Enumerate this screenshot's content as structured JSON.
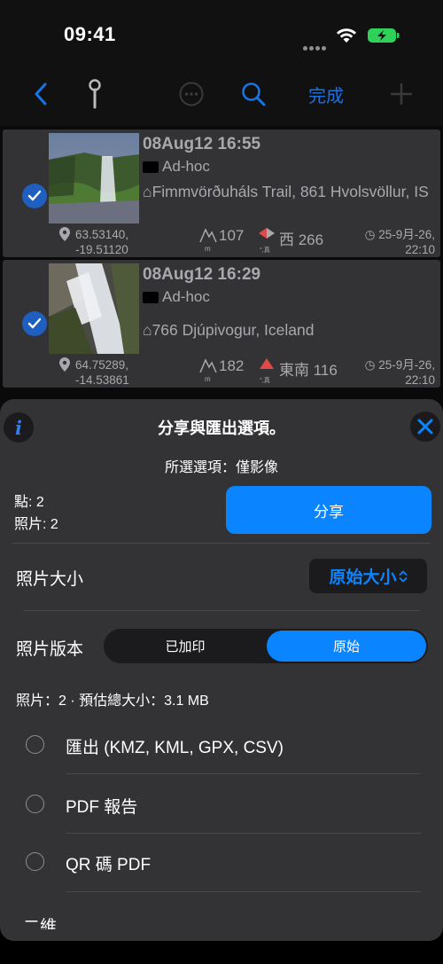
{
  "status_bar": {
    "time": "09:41"
  },
  "nav": {
    "done_label": "完成"
  },
  "photos": [
    {
      "title": "08Aug12 16:55",
      "folder": "Ad-hoc",
      "address": "⌂Fimmvörðuháls Trail, 861 Hvolsvöllur, IS",
      "lat": "63.53140,",
      "lon": "-19.51120",
      "altitude": "107",
      "altitude_unit": "m",
      "direction": "西 266",
      "direction_unit": "°,真",
      "date_line1": "25-9月-26,",
      "date_line2": "22:10",
      "selected": true
    },
    {
      "title": "08Aug12 16:29",
      "folder": "Ad-hoc",
      "address": "⌂766 Djúpivogur, Iceland",
      "lat": "64.75289,",
      "lon": "-14.53861",
      "altitude": "182",
      "altitude_unit": "m",
      "direction": "東南 116",
      "direction_unit": "°,真",
      "date_line1": "25-9月-26,",
      "date_line2": "22:10",
      "selected": true
    }
  ],
  "sheet": {
    "title": "分享與匯出選項。",
    "subtitle": "所選選項：僅影像",
    "points_label": "點: 2",
    "photos_label": "照片: 2",
    "share_label": "分享",
    "size_label": "照片大小",
    "size_value": "原始大小",
    "version_label": "照片版本",
    "version_options": [
      "已加印",
      "原始"
    ],
    "version_selected": "原始",
    "estimate": "照片：2 · 預估總大小：3.1 MB",
    "options": [
      {
        "label": "匯出 (KMZ, KML, GPX, CSV)",
        "checked": false
      },
      {
        "label": "PDF 報告",
        "checked": false
      },
      {
        "label": "QR 碼 PDF",
        "checked": false
      }
    ],
    "peek_label": "二維"
  },
  "colors": {
    "accent": "#0a84ff",
    "sheet_bg": "#333335",
    "row_bg": "#333336",
    "check_blue": "#1e5fbf"
  }
}
